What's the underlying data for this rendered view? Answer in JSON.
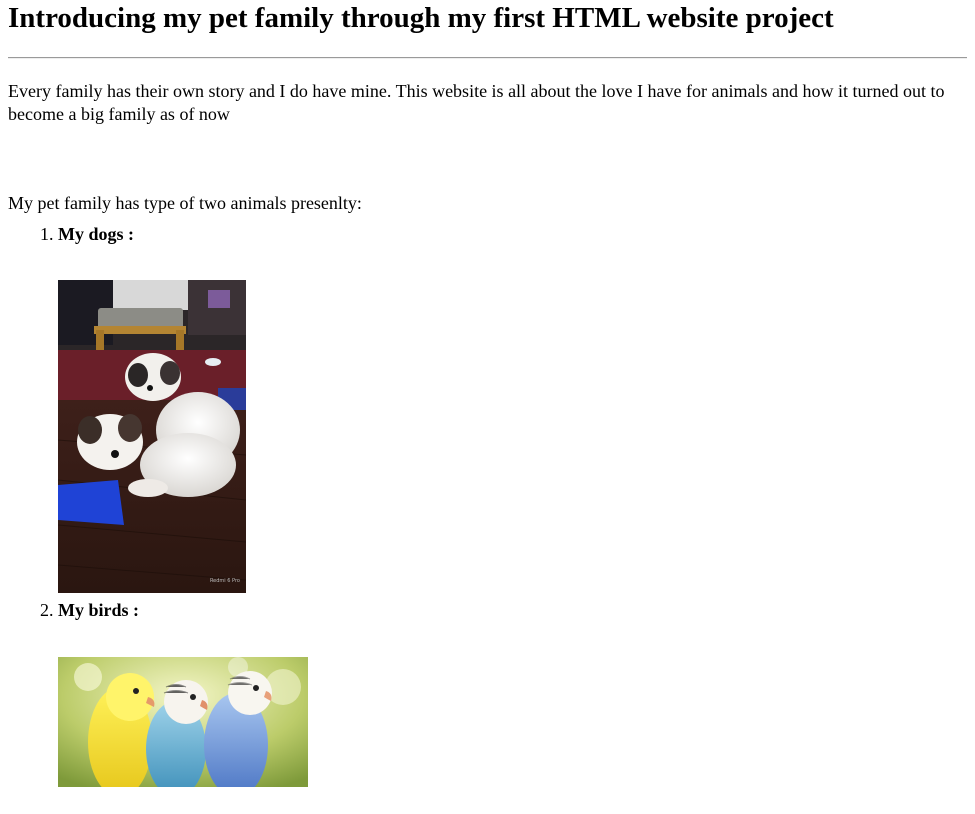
{
  "page": {
    "title": "Introducing my pet family through my first HTML website project",
    "intro": "Every family has their own story and I do have mine. This website is all about the love I have for animals and how it turned out to become a big family as of now",
    "lead": "My pet family has type of two animals presenlty:"
  },
  "list": {
    "items": [
      {
        "label": "My dogs :",
        "image": "two-puppies-photo"
      },
      {
        "label": "My birds :",
        "image": "three-budgies-photo"
      }
    ]
  },
  "photo": {
    "dogs_watermark": "Redmi 6 Pro"
  }
}
